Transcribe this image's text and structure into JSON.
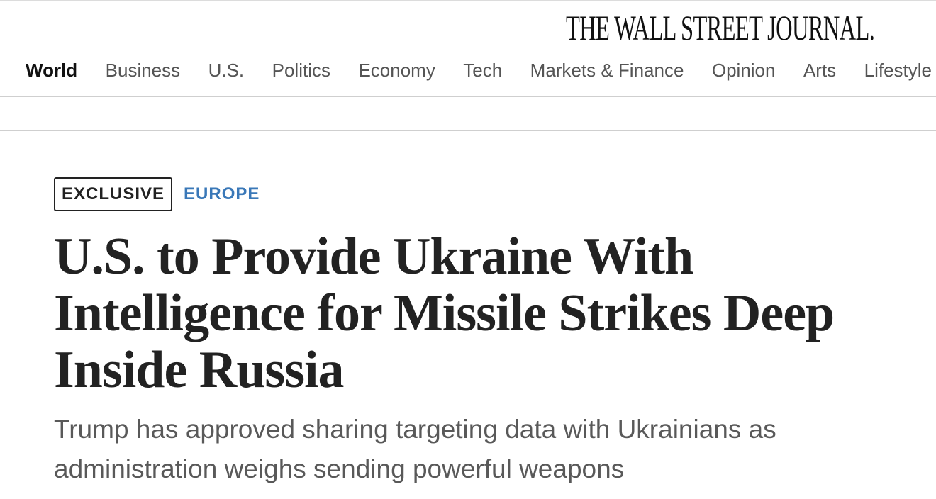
{
  "masthead": {
    "title": "THE WALL STREET JOURNAL."
  },
  "nav": {
    "items": [
      {
        "label": "World",
        "active": true
      },
      {
        "label": "Business"
      },
      {
        "label": "U.S."
      },
      {
        "label": "Politics"
      },
      {
        "label": "Economy"
      },
      {
        "label": "Tech"
      },
      {
        "label": "Markets & Finance"
      },
      {
        "label": "Opinion"
      },
      {
        "label": "Arts"
      },
      {
        "label": "Lifestyle"
      }
    ]
  },
  "article": {
    "badge": "EXCLUSIVE",
    "section": "EUROPE",
    "headline": "U.S. to Provide Ukraine With Intelligence for Missile Strikes Deep Inside Russia",
    "dek": "Trump has approved sharing targeting data with Ukrainians as administration weighs sending powerful weapons"
  },
  "colors": {
    "section": "#3a78b8",
    "text": "#222222",
    "dek": "#595959"
  }
}
